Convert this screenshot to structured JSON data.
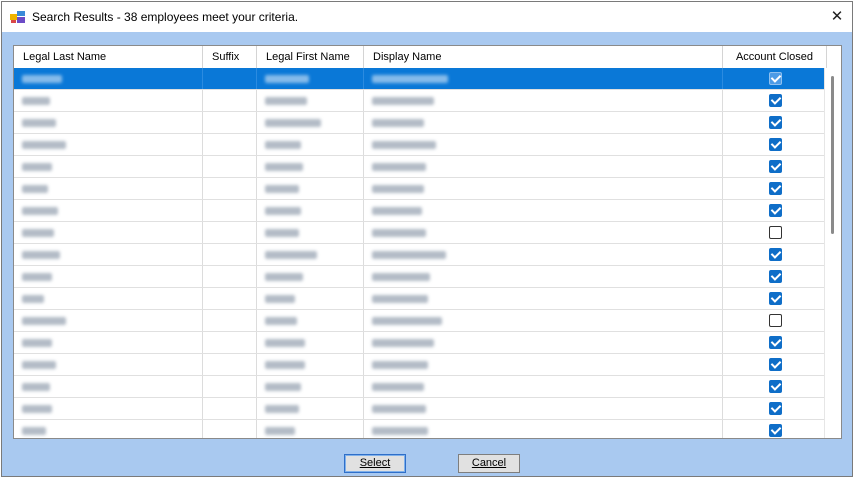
{
  "window": {
    "title": "Search Results - 38 employees meet your criteria.",
    "close_glyph": "✕",
    "icon": "app-window-icon"
  },
  "grid": {
    "columns": [
      {
        "key": "last",
        "label": "Legal Last Name"
      },
      {
        "key": "suffix",
        "label": "Suffix"
      },
      {
        "key": "first",
        "label": "Legal First Name"
      },
      {
        "key": "display",
        "label": "Display Name"
      },
      {
        "key": "closed",
        "label": "Account Closed"
      }
    ],
    "rows": [
      {
        "redacted": true,
        "account_closed": true,
        "selected": true
      },
      {
        "redacted": true,
        "account_closed": true
      },
      {
        "redacted": true,
        "account_closed": true
      },
      {
        "redacted": true,
        "account_closed": true
      },
      {
        "redacted": true,
        "account_closed": true
      },
      {
        "redacted": true,
        "account_closed": true
      },
      {
        "redacted": true,
        "account_closed": true
      },
      {
        "redacted": true,
        "account_closed": false
      },
      {
        "redacted": true,
        "account_closed": true
      },
      {
        "redacted": true,
        "account_closed": true
      },
      {
        "redacted": true,
        "account_closed": true
      },
      {
        "redacted": true,
        "account_closed": false
      },
      {
        "redacted": true,
        "account_closed": true
      },
      {
        "redacted": true,
        "account_closed": true
      },
      {
        "redacted": true,
        "account_closed": true
      },
      {
        "redacted": true,
        "account_closed": true
      },
      {
        "redacted": true,
        "account_closed": true
      },
      {
        "redacted": true,
        "account_closed": true
      }
    ]
  },
  "buttons": {
    "select_label": "Select",
    "cancel_label": "Cancel"
  },
  "colors": {
    "selection": "#0a78d7",
    "dialog_background": "#a9c9f0",
    "checkbox_checked": "#0f6ec8"
  }
}
